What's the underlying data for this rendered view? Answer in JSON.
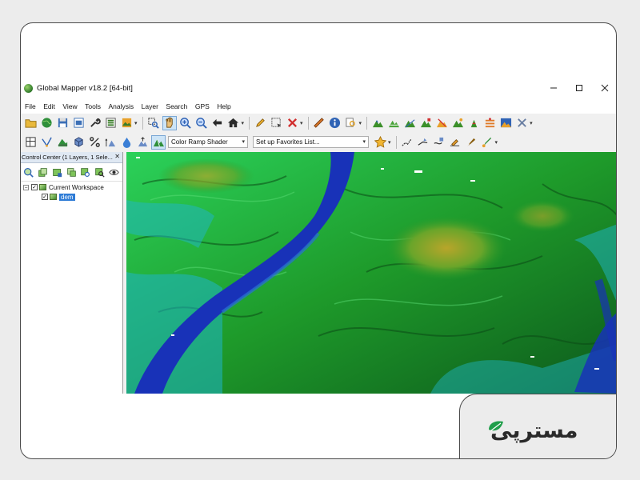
{
  "window": {
    "title": "Global Mapper v18.2  [64-bit]",
    "controls": [
      "minimize-icon",
      "maximize-icon",
      "close-icon"
    ]
  },
  "menu": [
    "File",
    "Edit",
    "View",
    "Tools",
    "Analysis",
    "Layer",
    "Search",
    "GPS",
    "Help"
  ],
  "toolbar": {
    "shader_select": "Color Ramp Shader",
    "favorites_select": "Set up Favorites List..."
  },
  "control_center": {
    "title": "Control Center (1 Layers, 1 Sele...",
    "close": "✕",
    "tree": {
      "workspace_label": "Current Workspace",
      "layer_label": "dem",
      "expander": "−",
      "check": "✓"
    }
  },
  "brand": {
    "logo_text": "مسترپی",
    "accent": "#1f9e4a"
  },
  "colors": {
    "map_water": "#1a2fb0",
    "map_low": "#21a8c9",
    "map_mid": "#2fb52a",
    "map_high": "#c9b52a"
  }
}
